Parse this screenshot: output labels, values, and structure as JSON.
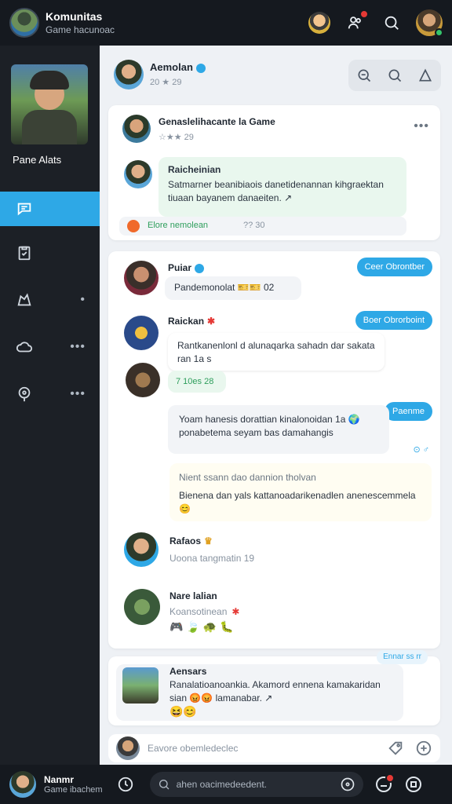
{
  "topbar": {
    "title": "Komunitas",
    "subtitle": "Game hacunoac",
    "icons": [
      "avatar-icon",
      "notifications-icon",
      "search-icon",
      "profile-avatar"
    ]
  },
  "sidebar": {
    "profile_name": "Pane Alats",
    "items": [
      {
        "icon": "chat-icon",
        "active": true
      },
      {
        "icon": "clipboard-icon",
        "active": false
      },
      {
        "icon": "map-icon",
        "active": false,
        "more": "•"
      },
      {
        "icon": "cloud-icon",
        "active": false,
        "more": "•••"
      },
      {
        "icon": "location-icon",
        "active": false,
        "more": "•••"
      }
    ]
  },
  "header": {
    "name": "Aemolan",
    "meta": "20 ★ 29",
    "tools": [
      "zoom-icon",
      "search-icon",
      "triangle-icon"
    ]
  },
  "post1": {
    "title": "Genaslelihacante la Game",
    "rating": "☆★★ 29",
    "more": "•••",
    "reply_name": "Raicheinian",
    "reply_text": "Satmarner beanibiaois danetidenannan kihgraektan tiuaan bayanem danaeiten. ↗",
    "footer_label": "Elore nemolean",
    "footer_meta": "?? 30"
  },
  "thread": {
    "m1": {
      "name": "Puiar",
      "text": "Pandemonolat 🎫🎫 02",
      "button": "Ceer Obrontber"
    },
    "m2": {
      "name": "Raickan",
      "text": "Rantkanenlonl d alunaqarka sahadn dar sakata ran 1a s",
      "button": "Boer Obrorboint"
    },
    "m3": {
      "meta": "7 10es 28"
    },
    "m4": {
      "text": "Yoam hanesis dorattian kinalonoidan 1a 🌍 ponabetema seyam bas damahangis",
      "button": "Paenme",
      "meta": "⊙ ♂"
    },
    "m5": {
      "title": "Nient ssann dao dannion tholvan",
      "text": "Bienena dan yals kattanoadarikenadlen anenescemmela 😊"
    },
    "m6": {
      "name": "Rafaos",
      "meta": "Uoona tangmatin 19"
    },
    "m7": {
      "name": "Nare lalian",
      "meta": "Koansotinean",
      "emojis": "🎮 🍃 🐢 🐛"
    }
  },
  "post3": {
    "tag": "Ennar ss rr",
    "name": "Aensars",
    "text": "Ranalatioanoankia. Akamord ennena kamakaridan sian 😡😡 lamanabar. ↗",
    "emojis": "😆😊"
  },
  "composer": {
    "placeholder": "Eavore obemledeclec"
  },
  "bottombar": {
    "name": "Nanmr",
    "subtitle": "Game ibachem",
    "search_placeholder": "ahen oacimedeedent."
  }
}
